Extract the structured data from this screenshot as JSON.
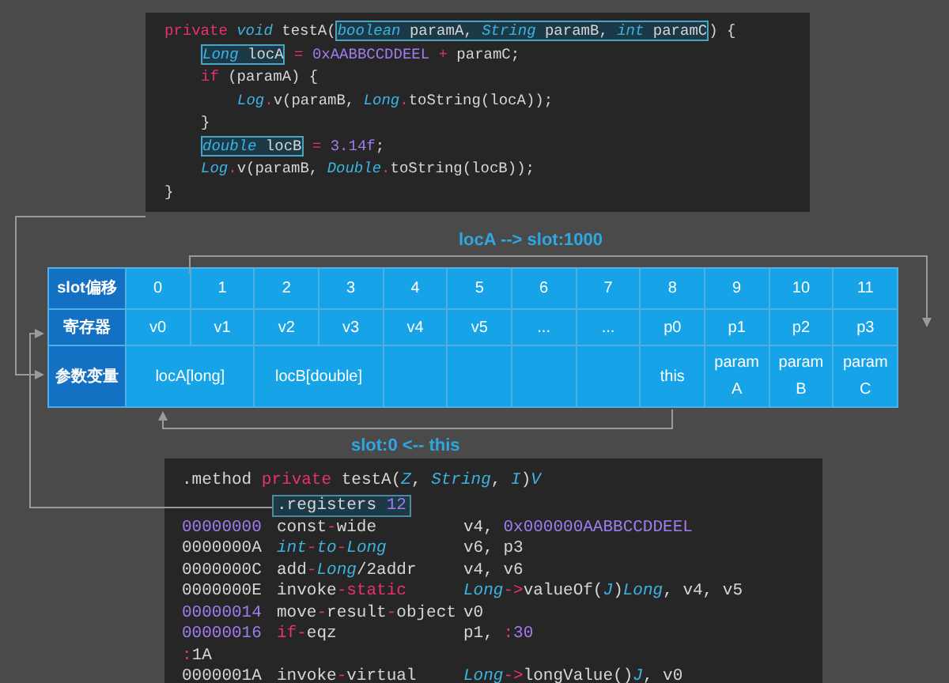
{
  "java_code": {
    "lines": [
      {
        "tokens": [
          {
            "text": "private ",
            "kind": "kw"
          },
          {
            "text": "void ",
            "kind": "ty"
          },
          {
            "text": "testA(",
            "kind": "p"
          },
          {
            "kind": "box",
            "children": [
              {
                "text": "boolean ",
                "kind": "ty"
              },
              {
                "text": "paramA, ",
                "kind": "p"
              },
              {
                "text": "String ",
                "kind": "ty"
              },
              {
                "text": "paramB, ",
                "kind": "p"
              },
              {
                "text": "int ",
                "kind": "ty"
              },
              {
                "text": "paramC",
                "kind": "p"
              }
            ]
          },
          {
            "text": ") {",
            "kind": "p"
          }
        ],
        "children": [
          {
            "tokens": [
              {
                "kind": "box",
                "children": [
                  {
                    "text": "Long ",
                    "kind": "ty"
                  },
                  {
                    "text": "locA",
                    "kind": "p"
                  }
                ]
              },
              {
                "text": " = ",
                "kind": "op"
              },
              {
                "text": "0xAABBCCDDEEL",
                "kind": "num"
              },
              {
                "text": " + ",
                "kind": "op"
              },
              {
                "text": "paramC;",
                "kind": "p"
              }
            ]
          },
          {
            "tokens": [
              {
                "text": "if",
                "kind": "kw"
              },
              {
                "text": " (paramA) {",
                "kind": "p"
              }
            ],
            "children": [
              {
                "tokens": [
                  {
                    "text": "Log",
                    "kind": "ty"
                  },
                  {
                    "text": ".",
                    "kind": "op"
                  },
                  {
                    "text": "v(paramB, ",
                    "kind": "p"
                  },
                  {
                    "text": "Long",
                    "kind": "ty"
                  },
                  {
                    "text": ".",
                    "kind": "op"
                  },
                  {
                    "text": "toString(locA));",
                    "kind": "p"
                  }
                ]
              }
            ]
          },
          {
            "tokens": [
              {
                "text": "}",
                "kind": "p"
              }
            ]
          },
          {
            "tokens": [
              {
                "kind": "box",
                "children": [
                  {
                    "text": "double ",
                    "kind": "ty"
                  },
                  {
                    "text": "locB",
                    "kind": "p"
                  }
                ]
              },
              {
                "text": " = ",
                "kind": "op"
              },
              {
                "text": "3.14f",
                "kind": "num"
              },
              {
                "text": ";",
                "kind": "p"
              }
            ]
          },
          {
            "tokens": [
              {
                "text": "Log",
                "kind": "ty"
              },
              {
                "text": ".",
                "kind": "op"
              },
              {
                "text": "v(paramB, ",
                "kind": "p"
              },
              {
                "text": "Double",
                "kind": "ty"
              },
              {
                "text": ".",
                "kind": "op"
              },
              {
                "text": "toString(locB));",
                "kind": "p"
              }
            ]
          }
        ]
      },
      {
        "tokens": [
          {
            "text": "}",
            "kind": "p"
          }
        ]
      }
    ]
  },
  "arrow_labels": [
    {
      "text": "locA --> slot:1000"
    },
    {
      "text": "slot:0 <-- this"
    }
  ],
  "slot_table": {
    "rows": [
      {
        "header": "slot偏移",
        "cells": [
          {
            "text": "0",
            "kind": "text"
          },
          {
            "text": "1",
            "kind": "text"
          },
          {
            "text": "2",
            "kind": "text"
          },
          {
            "text": "3",
            "kind": "text"
          },
          {
            "text": "4",
            "kind": "text"
          },
          {
            "text": "5",
            "kind": "text"
          },
          {
            "text": "6",
            "kind": "text"
          },
          {
            "text": "7",
            "kind": "text"
          },
          {
            "text": "8",
            "kind": "text"
          },
          {
            "text": "9",
            "kind": "text"
          },
          {
            "text": "10",
            "kind": "text"
          },
          {
            "text": "11",
            "kind": "text"
          }
        ]
      },
      {
        "header": "寄存器",
        "cells": [
          {
            "text": "v0",
            "kind": "text"
          },
          {
            "text": "v1",
            "kind": "text"
          },
          {
            "text": "v2",
            "kind": "text"
          },
          {
            "text": "v3",
            "kind": "text"
          },
          {
            "text": "v4",
            "kind": "text"
          },
          {
            "text": "v5",
            "kind": "text"
          },
          {
            "text": "...",
            "kind": "text"
          },
          {
            "text": "...",
            "kind": "text"
          },
          {
            "text": "p0",
            "kind": "text"
          },
          {
            "text": "p1",
            "kind": "text"
          },
          {
            "text": "p2",
            "kind": "text"
          },
          {
            "text": "p3",
            "kind": "text"
          }
        ]
      },
      {
        "header": "参数变量",
        "cells": [
          {
            "text": "locA[long]",
            "kind": "text",
            "colspan": 2
          },
          {
            "text": "locB[double]",
            "kind": "text",
            "colspan": 2
          },
          {
            "kind": "blank"
          },
          {
            "kind": "blank"
          },
          {
            "kind": "blank"
          },
          {
            "kind": "blank"
          },
          {
            "text": "this",
            "kind": "text"
          },
          {
            "text": "param A",
            "kind": "text"
          },
          {
            "text": "param B",
            "kind": "text"
          },
          {
            "text": "param C",
            "kind": "text"
          }
        ]
      }
    ]
  },
  "smali_code": {
    "header": [
      {
        "text": ".method ",
        "kind": "p"
      },
      {
        "text": "private ",
        "kind": "kw"
      },
      {
        "text": "testA(",
        "kind": "p"
      },
      {
        "text": "Z",
        "kind": "ty"
      },
      {
        "text": ", ",
        "kind": "p"
      },
      {
        "text": "String",
        "kind": "ty"
      },
      {
        "text": ", ",
        "kind": "p"
      },
      {
        "text": "I",
        "kind": "ty"
      },
      {
        "text": ")",
        "kind": "p"
      },
      {
        "text": "V",
        "kind": "ty"
      }
    ],
    "registers": [
      {
        "text": ".registers ",
        "kind": "p"
      },
      {
        "text": "12",
        "kind": "num"
      }
    ],
    "lines": [
      {
        "address": [
          {
            "text": "00000000",
            "kind": "num"
          }
        ],
        "instruction": [
          {
            "text": "const",
            "kind": "p"
          },
          {
            "text": "-",
            "kind": "op"
          },
          {
            "text": "wide",
            "kind": "p"
          }
        ],
        "operands": [
          {
            "text": "v4, ",
            "kind": "p"
          },
          {
            "text": "0x000000AABBCCDDEEL",
            "kind": "num"
          }
        ]
      },
      {
        "address": [
          {
            "text": "0000000A",
            "kind": "p"
          }
        ],
        "instruction": [
          {
            "text": "int",
            "kind": "ty"
          },
          {
            "text": "-",
            "kind": "op"
          },
          {
            "text": "to",
            "kind": "ty"
          },
          {
            "text": "-",
            "kind": "op"
          },
          {
            "text": "Long",
            "kind": "ty"
          }
        ],
        "operands": [
          {
            "text": "v6, p3",
            "kind": "p"
          }
        ]
      },
      {
        "address": [
          {
            "text": "0000000C",
            "kind": "p"
          }
        ],
        "instruction": [
          {
            "text": "add",
            "kind": "p"
          },
          {
            "text": "-",
            "kind": "op"
          },
          {
            "text": "Long",
            "kind": "ty"
          },
          {
            "text": "/2addr",
            "kind": "p"
          }
        ],
        "operands": [
          {
            "text": "v4, v6",
            "kind": "p"
          }
        ]
      },
      {
        "address": [
          {
            "text": "0000000E",
            "kind": "p"
          }
        ],
        "instruction": [
          {
            "text": "invoke",
            "kind": "p"
          },
          {
            "text": "-static",
            "kind": "kw"
          }
        ],
        "operands": [
          {
            "text": "Long",
            "kind": "ty"
          },
          {
            "text": "->",
            "kind": "op"
          },
          {
            "text": "valueOf(",
            "kind": "p"
          },
          {
            "text": "J",
            "kind": "ty"
          },
          {
            "text": ")",
            "kind": "p"
          },
          {
            "text": "Long",
            "kind": "ty"
          },
          {
            "text": ", v4, v5",
            "kind": "p"
          }
        ]
      },
      {
        "address": [
          {
            "text": "00000014",
            "kind": "num"
          }
        ],
        "instruction": [
          {
            "text": "move",
            "kind": "p"
          },
          {
            "text": "-",
            "kind": "op"
          },
          {
            "text": "result",
            "kind": "p"
          },
          {
            "text": "-",
            "kind": "op"
          },
          {
            "text": "object",
            "kind": "p"
          }
        ],
        "operands": [
          {
            "text": "v0",
            "kind": "p"
          }
        ]
      },
      {
        "address": [
          {
            "text": "00000016",
            "kind": "num"
          }
        ],
        "instruction": [
          {
            "text": "if",
            "kind": "kw"
          },
          {
            "text": "-",
            "kind": "op"
          },
          {
            "text": "eqz",
            "kind": "p"
          }
        ],
        "operands": [
          {
            "text": "p1, ",
            "kind": "p"
          },
          {
            "text": ":",
            "kind": "op"
          },
          {
            "text": "30",
            "kind": "num"
          }
        ]
      },
      {
        "address": [
          {
            "text": ":",
            "kind": "op"
          },
          {
            "text": "1A",
            "kind": "p"
          }
        ]
      },
      {
        "address": [
          {
            "text": "0000001A",
            "kind": "p"
          }
        ],
        "instruction": [
          {
            "text": "invoke",
            "kind": "p"
          },
          {
            "text": "-",
            "kind": "op"
          },
          {
            "text": "virtual",
            "kind": "p"
          }
        ],
        "operands": [
          {
            "text": "Long",
            "kind": "ty"
          },
          {
            "text": "->",
            "kind": "op"
          },
          {
            "text": "longValue()",
            "kind": "p"
          },
          {
            "text": "J",
            "kind": "ty"
          },
          {
            "text": ", v0",
            "kind": "p"
          }
        ]
      }
    ]
  }
}
